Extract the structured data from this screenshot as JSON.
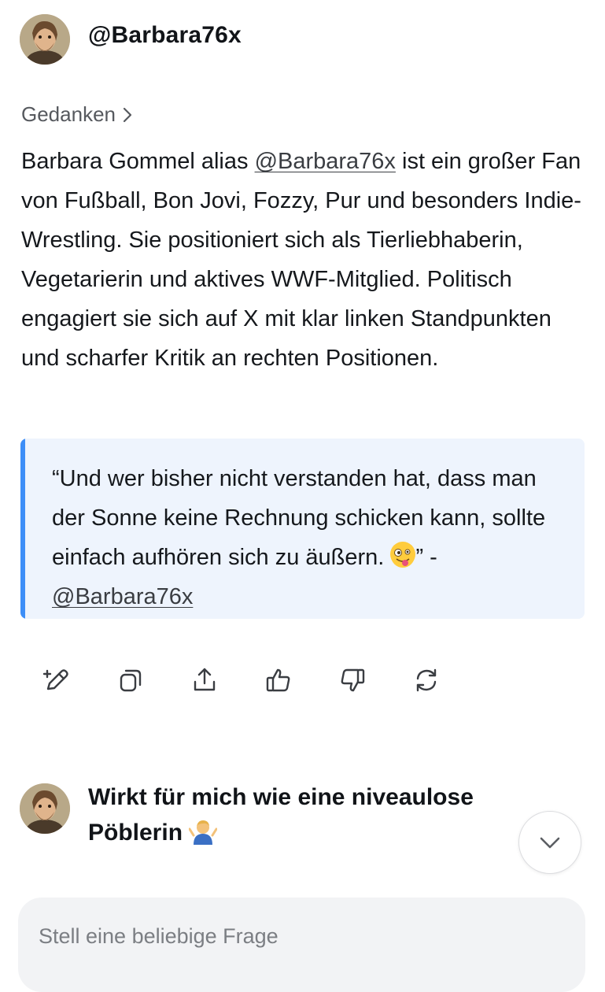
{
  "header": {
    "username": "@Barbara76x"
  },
  "response": {
    "thoughts_label": "Gedanken",
    "paragraph_part1": "Barbara Gommel alias ",
    "paragraph_mention": "@Barbara76x",
    "paragraph_part2": " ist ein großer Fan von Fußball, Bon Jovi, Fozzy, Pur und besonders Indie-Wrestling. Sie positioniert sich als Tierliebhaberin, Vegetarierin und aktives WWF-Mitglied. Politisch engagiert sie sich auf X mit klar linken Standpunkten und scharfer Kritik an rechten Positionen.",
    "quote_text": "“Und wer bisher nicht verstanden hat, dass man der Sonne keine Rechnung schicken kann, sollte einfach aufhören sich zu äußern. ",
    "quote_closing": "” -",
    "quote_mention": "@Barbara76x"
  },
  "actions": [
    {
      "icon": "edit-icon"
    },
    {
      "icon": "copy-icon"
    },
    {
      "icon": "share-icon"
    },
    {
      "icon": "thumbs-up-icon"
    },
    {
      "icon": "thumbs-down-icon"
    },
    {
      "icon": "regenerate-icon"
    }
  ],
  "user_message": {
    "text": "Wirkt für mich wie eine niveaulose Pöblerin "
  },
  "composer": {
    "placeholder": "Stell eine beliebige Frage"
  },
  "colors": {
    "quote_bar": "#3d8ef7",
    "quote_background": "#eef4fd",
    "composer_background": "#f2f3f5"
  }
}
